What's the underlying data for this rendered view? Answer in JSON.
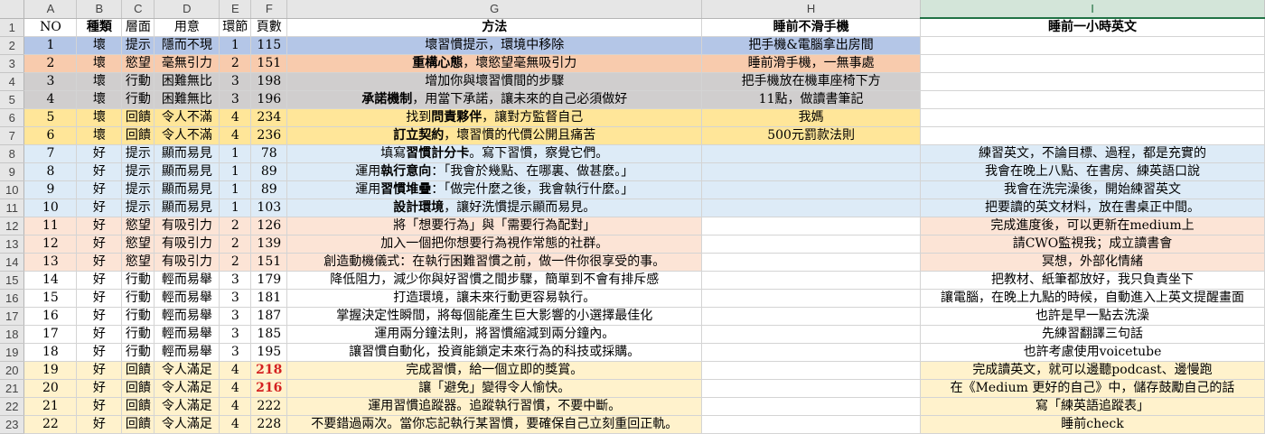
{
  "columns": [
    "A",
    "B",
    "C",
    "D",
    "E",
    "F",
    "G",
    "H",
    "I"
  ],
  "selected_column": "I",
  "header": {
    "row": "1",
    "cells": [
      "NO",
      "種類",
      "層面",
      "用意",
      "環節",
      "頁數",
      "方法",
      "睡前不滑手機",
      "睡前一小時英文"
    ]
  },
  "colors": {
    "blue": "#b4c6e7",
    "orange": "#f8cbad",
    "gray": "#d0cece",
    "yellow": "#ffe699",
    "lightblue": "#ddebf7",
    "lightorange": "#fce4d6",
    "lightyellow": "#fff2cc",
    "white": "#ffffff",
    "highlight_red": "#d42020"
  },
  "rows": [
    {
      "r": "2",
      "no": "1",
      "kind": "壞",
      "layer": "提示",
      "intent": "隱而不現",
      "step": "1",
      "page": "115",
      "method": "壞習慣提示，環境中移除",
      "h": "把手機&電腦拿出房間",
      "i": ""
    },
    {
      "r": "3",
      "no": "2",
      "kind": "壞",
      "layer": "慾望",
      "intent": "毫無引力",
      "step": "2",
      "page": "151",
      "method_bold": "重構心態",
      "method": "，壞慾望毫無吸引力",
      "h": "睡前滑手機，一無事處",
      "i": ""
    },
    {
      "r": "4",
      "no": "3",
      "kind": "壞",
      "layer": "行動",
      "intent": "困難無比",
      "step": "3",
      "page": "198",
      "method": "增加你與壞習慣間的步驟",
      "h": "把手機放在機車座椅下方",
      "i": ""
    },
    {
      "r": "5",
      "no": "4",
      "kind": "壞",
      "layer": "行動",
      "intent": "困難無比",
      "step": "3",
      "page": "196",
      "method_bold": "承諾機制",
      "method": "，用當下承諾，讓未來的自己必須做好",
      "h": "11點，做讀書筆記",
      "i": ""
    },
    {
      "r": "6",
      "no": "5",
      "kind": "壞",
      "layer": "回饋",
      "intent": "令人不滿",
      "step": "4",
      "page": "234",
      "method_pre": "找到",
      "method_bold": "問責夥伴",
      "method": "，讓對方監督自己",
      "h": "我媽",
      "i": ""
    },
    {
      "r": "7",
      "no": "6",
      "kind": "壞",
      "layer": "回饋",
      "intent": "令人不滿",
      "step": "4",
      "page": "236",
      "method_bold": "訂立契約",
      "method": "，壞習慣的代價公開且痛苦",
      "h": "500元罰款法則",
      "i": ""
    },
    {
      "r": "8",
      "no": "7",
      "kind": "好",
      "layer": "提示",
      "intent": "顯而易見",
      "step": "1",
      "page": "78",
      "method_pre": "填寫",
      "method_bold": "習慣計分卡",
      "method": "。寫下習慣，察覺它們。",
      "h": "",
      "i": "練習英文，不論目標、過程，都是充實的"
    },
    {
      "r": "9",
      "no": "8",
      "kind": "好",
      "layer": "提示",
      "intent": "顯而易見",
      "step": "1",
      "page": "89",
      "method_pre": "運用",
      "method_bold": "執行意向",
      "method": "：「我會於幾點、在哪裏、做甚麼。」",
      "h": "",
      "i": "我會在晚上八點、在書房、練英語口說"
    },
    {
      "r": "10",
      "no": "9",
      "kind": "好",
      "layer": "提示",
      "intent": "顯而易見",
      "step": "1",
      "page": "89",
      "method_pre": "運用",
      "method_bold": "習慣堆疊",
      "method": "：「做完什麼之後，我會執行什麼。」",
      "h": "",
      "i": "我會在洗完澡後，開始練習英文"
    },
    {
      "r": "11",
      "no": "10",
      "kind": "好",
      "layer": "提示",
      "intent": "顯而易見",
      "step": "1",
      "page": "103",
      "method_bold": "設計環境",
      "method": "，讓好洗慣提示顯而易見。",
      "h": "",
      "i": "把要讀的英文材料，放在書桌正中間。"
    },
    {
      "r": "12",
      "no": "11",
      "kind": "好",
      "layer": "慾望",
      "intent": "有吸引力",
      "step": "2",
      "page": "126",
      "method": "將「想要行為」與「需要行為配對」",
      "h": "",
      "i": "完成進度後，可以更新在medium上"
    },
    {
      "r": "13",
      "no": "12",
      "kind": "好",
      "layer": "慾望",
      "intent": "有吸引力",
      "step": "2",
      "page": "139",
      "method": "加入一個把你想要行為視作常態的社群。",
      "h": "",
      "i": "請CWO監視我；成立讀書會"
    },
    {
      "r": "14",
      "no": "13",
      "kind": "好",
      "layer": "慾望",
      "intent": "有吸引力",
      "step": "2",
      "page": "151",
      "method": "創造動機儀式：在執行困難習慣之前，做一件你很享受的事。",
      "h": "",
      "i": "冥想，外部化情緒"
    },
    {
      "r": "15",
      "no": "14",
      "kind": "好",
      "layer": "行動",
      "intent": "輕而易舉",
      "step": "3",
      "page": "179",
      "method": "降低阻力，減少你與好習慣之間步驟，簡單到不會有排斥感",
      "h": "",
      "i": "把教材、紙筆都放好，我只負責坐下"
    },
    {
      "r": "16",
      "no": "15",
      "kind": "好",
      "layer": "行動",
      "intent": "輕而易舉",
      "step": "3",
      "page": "181",
      "method": "打造環境，讓未來行動更容易執行。",
      "h": "",
      "i": "讓電腦，在晚上九點的時候，自動進入上英文提醒畫面"
    },
    {
      "r": "17",
      "no": "16",
      "kind": "好",
      "layer": "行動",
      "intent": "輕而易舉",
      "step": "3",
      "page": "187",
      "method": "掌握決定性瞬間，將每個能產生巨大影響的小選擇最佳化",
      "h": "",
      "i": "也許是早一點去洗澡"
    },
    {
      "r": "18",
      "no": "17",
      "kind": "好",
      "layer": "行動",
      "intent": "輕而易舉",
      "step": "3",
      "page": "185",
      "method": "運用兩分鐘法則，將習慣縮減到兩分鐘內。",
      "h": "",
      "i": "先練習翻譯三句話"
    },
    {
      "r": "19",
      "no": "18",
      "kind": "好",
      "layer": "行動",
      "intent": "輕而易舉",
      "step": "3",
      "page": "195",
      "method": "讓習慣自動化，投資能鎖定未來行為的科技或採購。",
      "h": "",
      "i": "也許考慮使用voicetube"
    },
    {
      "r": "20",
      "no": "19",
      "kind": "好",
      "layer": "回饋",
      "intent": "令人滿足",
      "step": "4",
      "page": "218",
      "page_red": true,
      "method": "完成習慣，給一個立即的獎賞。",
      "h": "",
      "i": "完成讀英文，就可以邊聽podcast、邊慢跑"
    },
    {
      "r": "21",
      "no": "20",
      "kind": "好",
      "layer": "回饋",
      "intent": "令人滿足",
      "step": "4",
      "page": "216",
      "page_red": true,
      "method": "讓「避免」變得令人愉快。",
      "h": "",
      "i": "在《Medium 更好的自己》中，儲存鼓勵自己的話"
    },
    {
      "r": "22",
      "no": "21",
      "kind": "好",
      "layer": "回饋",
      "intent": "令人滿足",
      "step": "4",
      "page": "222",
      "method": "運用習慣追蹤器。追蹤執行習慣，不要中斷。",
      "h": "",
      "i": "寫「練英語追蹤表」"
    },
    {
      "r": "23",
      "no": "22",
      "kind": "好",
      "layer": "回饋",
      "intent": "令人滿足",
      "step": "4",
      "page": "228",
      "method": "不要錯過兩次。當你忘記執行某習慣，要確保自己立刻重回正軌。",
      "h": "",
      "i": "睡前check"
    }
  ]
}
